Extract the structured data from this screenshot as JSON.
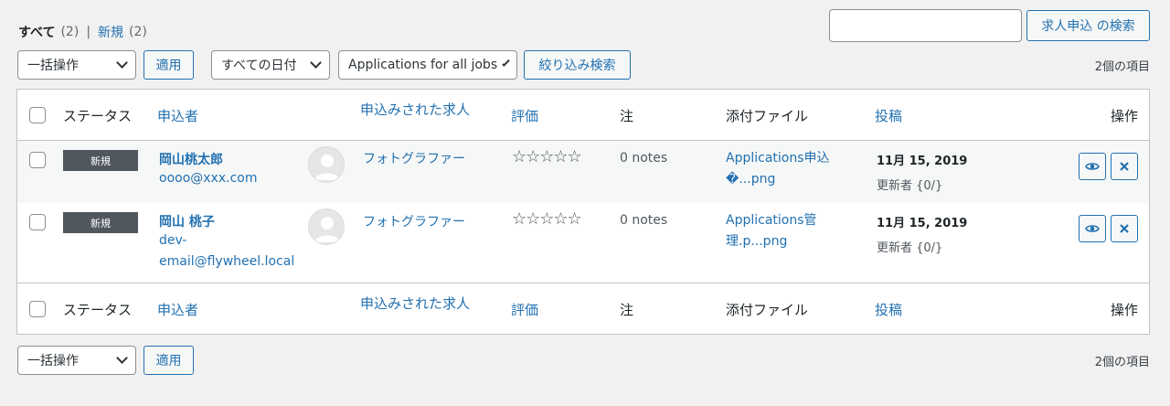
{
  "views": {
    "all_label": "すべて",
    "all_count": "(2)",
    "separator": "|",
    "new_label": "新規",
    "new_count": "(2)"
  },
  "search": {
    "value": "",
    "button_label": "求人申込 の検索"
  },
  "bulk_actions": {
    "selected": "一括操作",
    "apply_label": "適用"
  },
  "filters": {
    "date_selected": "すべての日付",
    "job_selected": "Applications for all jobs",
    "filter_button": "絞り込み検索"
  },
  "items_count": "2個の項目",
  "columns": {
    "status": "ステータス",
    "applicant": "申込者",
    "job": "申込みされた求人",
    "rating": "評価",
    "notes": "注",
    "attachment": "添付ファイル",
    "posted": "投稿",
    "actions": "操作"
  },
  "rows": [
    {
      "status": "新規",
      "name": "岡山桃太郎",
      "email_line1": "oooo@xxx.com",
      "email_line2": "",
      "email_line3": "",
      "job": "フォトグラファー",
      "rating": "☆☆☆☆☆",
      "notes": "0 notes",
      "attach_line1": "Applications申込",
      "attach_line2": "�...png",
      "date": "11月 15, 2019",
      "updated_by": "更新者 {0/}"
    },
    {
      "status": "新規",
      "name": "岡山 桃子",
      "email_line1": "dev-",
      "email_line2": "email@flywheel.local",
      "email_line3": "",
      "job": "フォトグラファー",
      "rating": "☆☆☆☆☆",
      "notes": "0 notes",
      "attach_line1": "Applications管",
      "attach_line2": "理.p...png",
      "date": "11月 15, 2019",
      "updated_by": "更新者 {0/}"
    }
  ],
  "icons": {
    "view": "eye-icon",
    "delete": "close-icon",
    "avatar": "user-avatar-icon",
    "dropdown": "chevron-down-icon"
  },
  "colors": {
    "link": "#2271b1",
    "badge": "#50575e",
    "background": "#f1f1f1"
  }
}
